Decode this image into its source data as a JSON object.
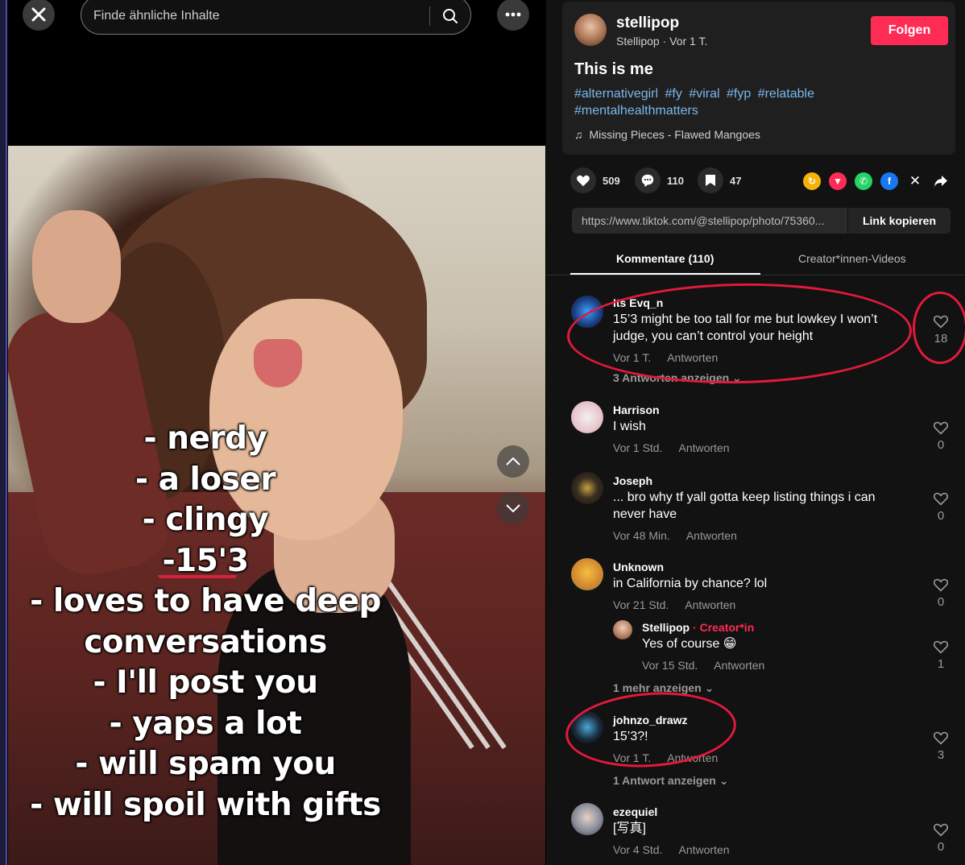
{
  "search": {
    "placeholder": "Finde ähnliche Inhalte"
  },
  "overlay_lines": [
    "- nerdy",
    "- a loser",
    "- clingy",
    "-15'3",
    "- loves to have deep",
    "conversations",
    "- I'll post you",
    "- yaps a lot",
    "- will spam you",
    "- will spoil with gifts"
  ],
  "post": {
    "author": "stellipop",
    "author_sub": "Stellipop · Vor 1 T.",
    "follow_label": "Folgen",
    "caption": "This is me",
    "hashtags": [
      "#alternativegirl",
      "#fy",
      "#viral",
      "#fyp",
      "#relatable",
      "#mentalhealthmatters"
    ],
    "music": "Missing Pieces - Flawed Mangoes"
  },
  "actions": {
    "likes": "509",
    "comments": "110",
    "saves": "47"
  },
  "share_icons": [
    "repost-icon",
    "send-icon",
    "whatsapp-icon",
    "facebook-icon",
    "x-icon",
    "share-arrow-icon"
  ],
  "link": {
    "url": "https://www.tiktok.com/@stellipop/photo/75360...",
    "copy_label": "Link kopieren"
  },
  "tabs": [
    {
      "label": "Kommentare (110)"
    },
    {
      "label": "Creator*innen-Videos"
    }
  ],
  "comments": [
    {
      "user": "Its Evq_n",
      "text": "15’3 might be too tall for me but lowkey I won’t judge, you can’t control your height",
      "time": "Vor 1 T.",
      "reply": "Antworten",
      "likes": "18",
      "more": "3 Antworten anzeigen"
    },
    {
      "user": "Harrison",
      "text": "I wish",
      "time": "Vor 1 Std.",
      "reply": "Antworten",
      "likes": "0"
    },
    {
      "user": "Joseph",
      "text": "... bro why tf yall gotta keep listing things i can never have",
      "time": "Vor 48 Min.",
      "reply": "Antworten",
      "likes": "0"
    },
    {
      "user": "Unknown",
      "text": "in California by chance? lol",
      "time": "Vor 21 Std.",
      "reply": "Antworten",
      "likes": "0"
    },
    {
      "user": "Stellipop",
      "creator_tag": "· Creator*in",
      "text": "Yes of course 😁",
      "time": "Vor 15 Std.",
      "reply": "Antworten",
      "likes": "1",
      "more": "1 mehr anzeigen"
    },
    {
      "user": "johnzo_drawz",
      "text": "15’3?!",
      "time": "Vor 1 T.",
      "reply": "Antworten",
      "likes": "3",
      "more": "1 Antwort anzeigen"
    },
    {
      "user": "ezequiel",
      "text": "[写真]",
      "time": "Vor 4 Std.",
      "reply": "Antworten",
      "likes": "0"
    }
  ],
  "colors": {
    "accent": "#fe2c55",
    "hashtag": "#7ab8ef",
    "annotation": "#e3193b"
  }
}
